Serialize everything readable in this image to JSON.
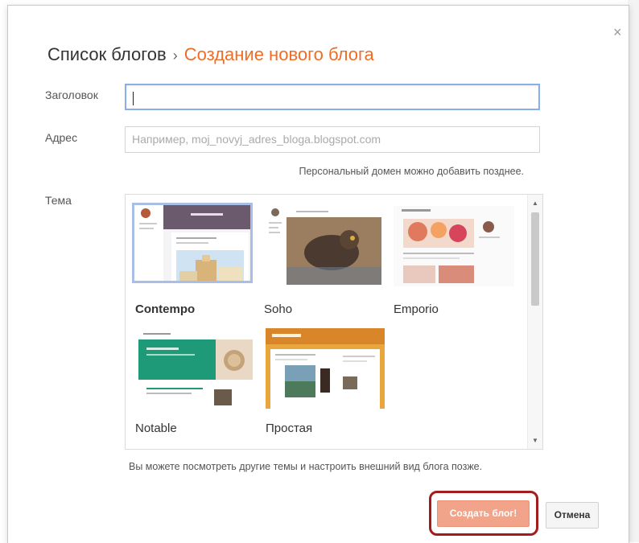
{
  "header": {
    "breadcrumb_root": "Список блогов",
    "separator": "›",
    "current": "Создание нового блога",
    "close_glyph": "×"
  },
  "form": {
    "title_label": "Заголовок",
    "title_value": "",
    "address_label": "Адрес",
    "address_placeholder": "Например, moj_novyj_adres_bloga.blogspot.com",
    "address_hint": "Персональный домен можно добавить позднее.",
    "theme_label": "Тема"
  },
  "themes": [
    {
      "name": "Contempo",
      "selected": true
    },
    {
      "name": "Soho",
      "selected": false
    },
    {
      "name": "Emporio",
      "selected": false
    },
    {
      "name": "Notable",
      "selected": false
    },
    {
      "name": "Простая",
      "selected": false
    }
  ],
  "theme_hint": "Вы можете посмотреть другие темы и настроить внешний вид блога позже.",
  "actions": {
    "create_label": "Создать блог!",
    "cancel_label": "Отмена"
  },
  "colors": {
    "accent": "#ee6d27",
    "create_button": "#f2a48a",
    "highlight": "#a31c1c",
    "focus_border": "#8aaee9"
  }
}
